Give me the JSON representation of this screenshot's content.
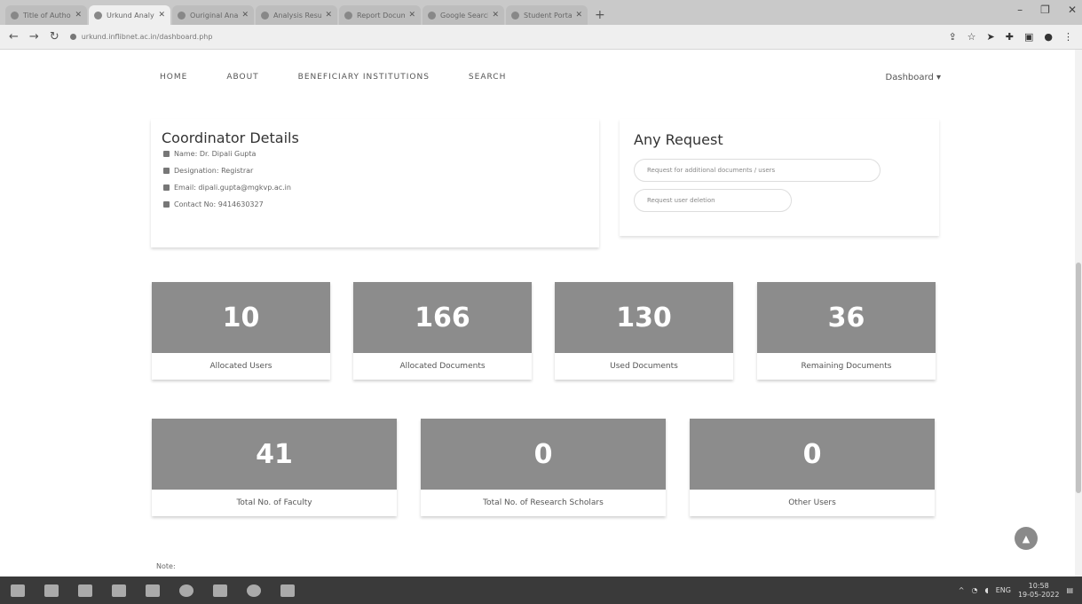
{
  "browser": {
    "tabs": [
      {
        "label": "Title of Authors",
        "active": false
      },
      {
        "label": "Urkund Analysis",
        "active": true
      },
      {
        "label": "Ouriginal Analysis",
        "active": false
      },
      {
        "label": "Analysis Result",
        "active": false
      },
      {
        "label": "Report Document",
        "active": false
      },
      {
        "label": "Google Search",
        "active": false
      },
      {
        "label": "Student Portal",
        "active": false
      }
    ],
    "url": "urkund.inflibnet.ac.in/dashboard.php",
    "window_controls": [
      "–",
      "❐",
      "✕"
    ]
  },
  "nav": {
    "items": [
      "HOME",
      "ABOUT",
      "BENEFICIARY INSTITUTIONS",
      "SEARCH"
    ],
    "dashboard": "Dashboard ▾"
  },
  "coordinator": {
    "title": "Coordinator Details",
    "name": "Name: Dr. Dipali Gupta",
    "designation": "Designation: Registrar",
    "email": "Email: dipali.gupta@mgkvp.ac.in",
    "contact": "Contact No: 9414630327"
  },
  "request": {
    "title": "Any Request",
    "btn1": "Request for additional documents / users",
    "btn2": "Request user deletion"
  },
  "stats_row1": [
    {
      "value": "10",
      "label": "Allocated Users"
    },
    {
      "value": "166",
      "label": "Allocated Documents"
    },
    {
      "value": "130",
      "label": "Used Documents"
    },
    {
      "value": "36",
      "label": "Remaining Documents"
    }
  ],
  "stats_row2": [
    {
      "value": "41",
      "label": "Total No. of Faculty"
    },
    {
      "value": "0",
      "label": "Total No. of Research Scholars"
    },
    {
      "value": "0",
      "label": "Other Users"
    }
  ],
  "note": "Note:",
  "taskbar": {
    "time": "10:58",
    "date": "19-05-2022",
    "lang": "ENG"
  }
}
